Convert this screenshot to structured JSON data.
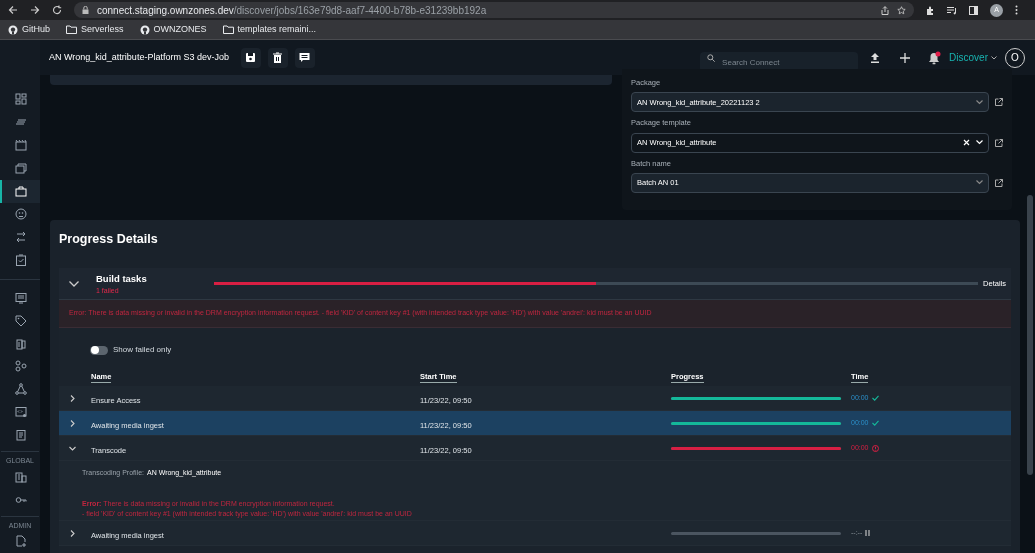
{
  "browser": {
    "url_host": "connect.staging.ownzones.dev",
    "url_path": "/discover/jobs/163e79d8-aaf7-4400-b78b-e31239bb192a",
    "profile_initial": "A",
    "bookmarks": [
      {
        "label": "GitHub",
        "kind": "github"
      },
      {
        "label": "Serverless",
        "kind": "folder"
      },
      {
        "label": "OWNZONES",
        "kind": "github"
      },
      {
        "label": "templates remaini...",
        "kind": "folder"
      }
    ]
  },
  "header": {
    "title": "AN Wrong_kid_attribute-Platform S3 dev-Job",
    "search_placeholder": "Search Connect",
    "has_unread": true,
    "menu": "Discover",
    "avatar": "O"
  },
  "sidebar": {
    "items": [
      {
        "selected": false
      },
      {
        "selected": false
      },
      {
        "selected": false
      },
      {
        "selected": false
      },
      {
        "selected": true
      },
      {
        "selected": false
      },
      {
        "selected": false
      },
      {
        "selected": false
      }
    ],
    "items_2": [
      {
        "selected": false
      },
      {
        "selected": false
      },
      {
        "selected": false
      },
      {
        "selected": false
      },
      {
        "selected": false
      },
      {
        "selected": false
      },
      {
        "selected": false
      }
    ],
    "sections": [
      {
        "label": "GLOBAL",
        "items": [
          {
            "selected": false
          },
          {
            "selected": false
          }
        ]
      },
      {
        "label": "ADMIN",
        "items": [
          {
            "selected": false
          }
        ]
      }
    ]
  },
  "form": [
    {
      "label": "Package",
      "value": "AN Wrong_kid_attribute_20221123 2",
      "clearable": false
    },
    {
      "label": "Package template",
      "value": "AN Wrong_kid_attribute",
      "clearable": true
    },
    {
      "label": "Batch name",
      "value": "Batch AN 01",
      "clearable": false
    }
  ],
  "progress": {
    "title": "Progress Details",
    "group": {
      "title": "Build tasks",
      "subtitle": "1 failed",
      "expanded": true,
      "level": 0.5,
      "details": "Details",
      "error": "Error: There is data missing or invalid in the DRM encryption information request. - field 'KID' of content key #1 (with intended track type value: 'HD') with value 'andrei': kid must be an UUID"
    },
    "toggle": {
      "label": "Show failed only",
      "on": false
    },
    "columns": [
      "Name",
      "Start Time",
      "Progress",
      "Time"
    ],
    "rows": [
      {
        "name": "Ensure Access",
        "start": "11/23/22, 09:50",
        "level": 1,
        "time": "00:00",
        "kind": "done",
        "expanded": false,
        "selected": false
      },
      {
        "name": "Awaiting media ingest",
        "start": "11/23/22, 09:50",
        "level": 1,
        "time": "00:00",
        "kind": "done",
        "expanded": false,
        "selected": true
      },
      {
        "name": "Transcode",
        "start": "11/23/22, 09:50",
        "level": 1,
        "time": "00:00",
        "kind": "failed",
        "expanded": true,
        "selected": false,
        "profile_label": "Transcoding Profile:",
        "profile_value": "AN Wrong_kid_attribute",
        "error_lines": [
          "**Error:** There is data missing or invalid in the DRM encryption information request.",
          "- field 'KID' of content key #1 (with intended track type value: 'HD') with value 'andrei': kid must be an UUID"
        ]
      },
      {
        "name": "Awaiting media ingest",
        "level": 0,
        "time": "--:--",
        "kind": "paused",
        "expanded": false,
        "selected": false
      }
    ]
  }
}
